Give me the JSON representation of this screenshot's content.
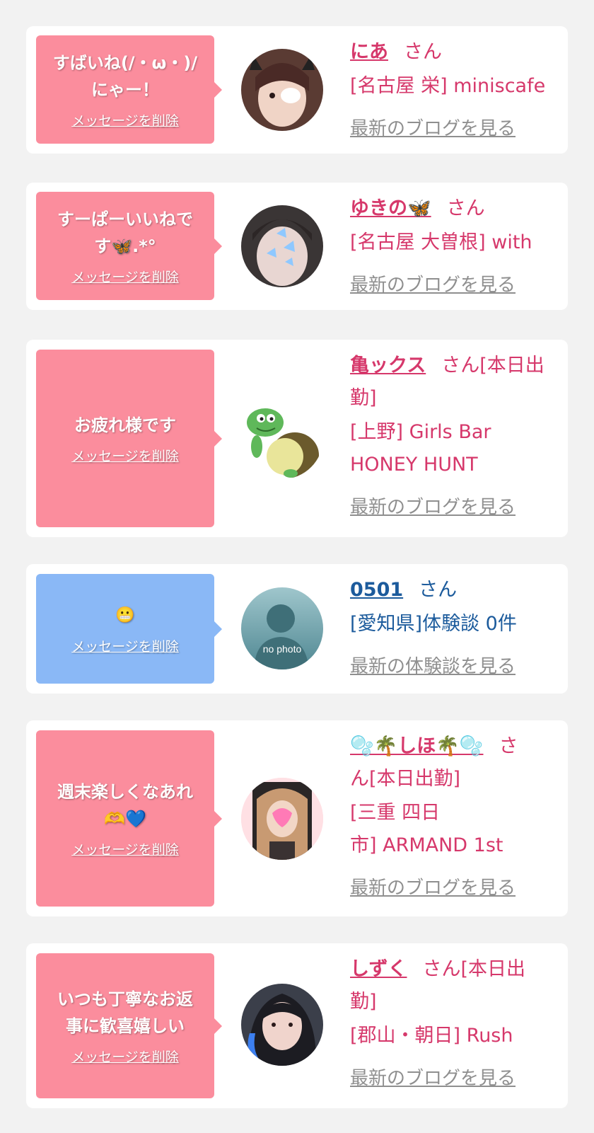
{
  "colors": {
    "pink_bubble": "#fb8d9d",
    "blue_bubble": "#8ab8f6",
    "pink_text": "#d6386b",
    "blue_text": "#1c5b9c",
    "link_gray": "#8f8f8f"
  },
  "delete_label": "メッセージを削除",
  "cards": [
    {
      "message_lines": [
        "すばいね(/・ω・)/",
        "にゃー！"
      ],
      "name": "にあ",
      "suffix": "さん",
      "location_lines": [
        "[名古屋 栄] miniscafe"
      ],
      "link": "最新のブログを見る"
    },
    {
      "message_lines": [
        "すーぱーいいねで",
        "す🦋.*°"
      ],
      "name": "ゆきの🦋",
      "suffix": "さん",
      "location_lines": [
        "[名古屋 大曽根] with"
      ],
      "link": "最新のブログを見る"
    },
    {
      "message_lines": [
        "お疲れ様です"
      ],
      "name": "亀ックス",
      "suffix": "さん[本日出",
      "suffix2": "勤]",
      "location_lines": [
        "[上野] Girls Bar",
        "HONEY HUNT"
      ],
      "link": "最新のブログを見る"
    },
    {
      "message_lines": [
        "😬"
      ],
      "name": "0501",
      "suffix": "さん",
      "location_lines": [
        "[愛知県]体験談 0件"
      ],
      "link": "最新の体験談を見る",
      "avatar_text": "no photo"
    },
    {
      "message_lines": [
        "週末楽しくなあれ",
        "🫶💙"
      ],
      "name": "🫧🌴しほ🌴🫧",
      "suffix": "さ",
      "suffix2": "ん[本日出勤]",
      "location_lines": [
        "[三重 四日",
        "市] ARMAND 1st"
      ],
      "link": "最新のブログを見る"
    },
    {
      "message_lines": [
        "いつも丁寧なお返",
        "事に歓喜嬉しい"
      ],
      "name": "しずく",
      "suffix": "さん[本日出",
      "suffix2": "勤]",
      "location_lines": [
        "[郡山・朝日] Rush"
      ],
      "link": "最新のブログを見る"
    }
  ]
}
